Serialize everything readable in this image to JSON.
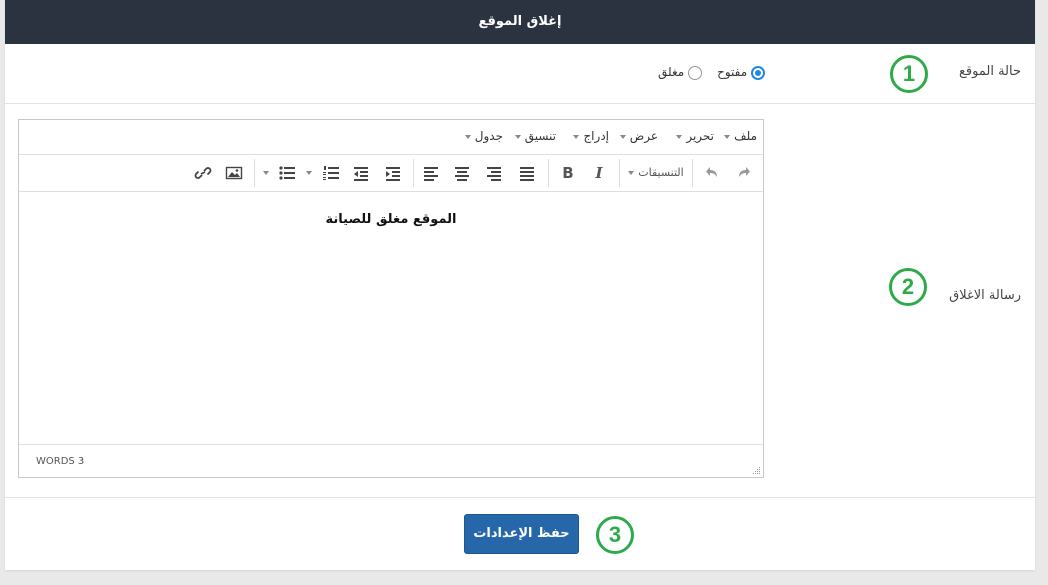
{
  "header": {
    "title": "إغلاق الموقع"
  },
  "site_status": {
    "label": "حالة الموقع",
    "badge": "1",
    "options": [
      {
        "label": "مفتوح",
        "checked": true
      },
      {
        "label": "مغلق",
        "checked": false
      }
    ]
  },
  "close_message": {
    "label": "رسالة الاغلاق",
    "badge": "2"
  },
  "editor": {
    "menu": [
      "ملف",
      "تحرير",
      "عرض",
      "إدراج",
      "تنسيق",
      "جدول"
    ],
    "formats_label": "التنسيقات",
    "content": "الموقع مغلق للصيانة",
    "word_count": "WORDS 3"
  },
  "footer": {
    "save_label": "حفظ الإعدادات",
    "badge": "3"
  }
}
